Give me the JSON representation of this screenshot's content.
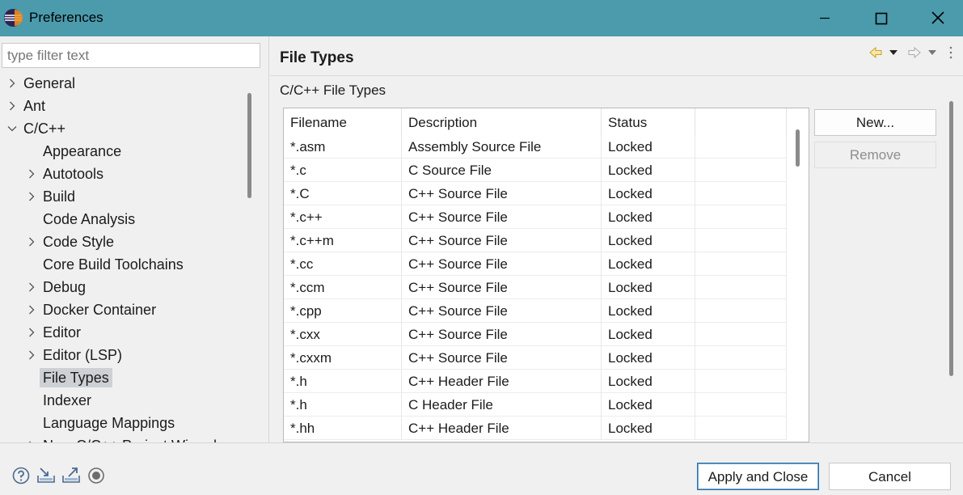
{
  "window": {
    "title": "Preferences"
  },
  "filter": {
    "placeholder": "type filter text"
  },
  "tree": [
    {
      "label": "General",
      "expandable": true,
      "expanded": false,
      "level": 0
    },
    {
      "label": "Ant",
      "expandable": true,
      "expanded": false,
      "level": 0
    },
    {
      "label": "C/C++",
      "expandable": true,
      "expanded": true,
      "level": 0
    },
    {
      "label": "Appearance",
      "expandable": false,
      "level": 1
    },
    {
      "label": "Autotools",
      "expandable": true,
      "expanded": false,
      "level": 1
    },
    {
      "label": "Build",
      "expandable": true,
      "expanded": false,
      "level": 1
    },
    {
      "label": "Code Analysis",
      "expandable": false,
      "level": 1
    },
    {
      "label": "Code Style",
      "expandable": true,
      "expanded": false,
      "level": 1
    },
    {
      "label": "Core Build Toolchains",
      "expandable": false,
      "level": 1
    },
    {
      "label": "Debug",
      "expandable": true,
      "expanded": false,
      "level": 1
    },
    {
      "label": "Docker Container",
      "expandable": true,
      "expanded": false,
      "level": 1
    },
    {
      "label": "Editor",
      "expandable": true,
      "expanded": false,
      "level": 1
    },
    {
      "label": "Editor (LSP)",
      "expandable": true,
      "expanded": false,
      "level": 1
    },
    {
      "label": "File Types",
      "expandable": false,
      "level": 1,
      "selected": true
    },
    {
      "label": "Indexer",
      "expandable": false,
      "level": 1
    },
    {
      "label": "Language Mappings",
      "expandable": false,
      "level": 1
    },
    {
      "label": "New C/C++ Project Wizard",
      "expandable": true,
      "expanded": false,
      "level": 1
    }
  ],
  "page": {
    "title": "File Types",
    "section_label": "C/C++ File Types"
  },
  "table": {
    "columns": [
      "Filename",
      "Description",
      "Status"
    ],
    "rows": [
      [
        "*.asm",
        "Assembly Source File",
        "Locked"
      ],
      [
        "*.c",
        "C Source File",
        "Locked"
      ],
      [
        "*.C",
        "C++ Source File",
        "Locked"
      ],
      [
        "*.c++",
        "C++ Source File",
        "Locked"
      ],
      [
        "*.c++m",
        "C++ Source File",
        "Locked"
      ],
      [
        "*.cc",
        "C++ Source File",
        "Locked"
      ],
      [
        "*.ccm",
        "C++ Source File",
        "Locked"
      ],
      [
        "*.cpp",
        "C++ Source File",
        "Locked"
      ],
      [
        "*.cxx",
        "C++ Source File",
        "Locked"
      ],
      [
        "*.cxxm",
        "C++ Source File",
        "Locked"
      ],
      [
        "*.h",
        "C++ Header File",
        "Locked"
      ],
      [
        "*.h",
        "C Header File",
        "Locked"
      ],
      [
        "*.hh",
        "C++ Header File",
        "Locked"
      ]
    ]
  },
  "buttons": {
    "new": "New...",
    "remove": "Remove",
    "apply_close": "Apply and Close",
    "cancel": "Cancel"
  },
  "icons": {
    "back": "back-arrow-icon",
    "forward": "forward-arrow-icon",
    "help": "help-icon",
    "import": "import-icon",
    "export": "export-icon",
    "record": "record-icon"
  },
  "colors": {
    "titlebar": "#4b9bad",
    "selection": "#cdd1d5",
    "default_button_border": "#2c6fa8"
  }
}
